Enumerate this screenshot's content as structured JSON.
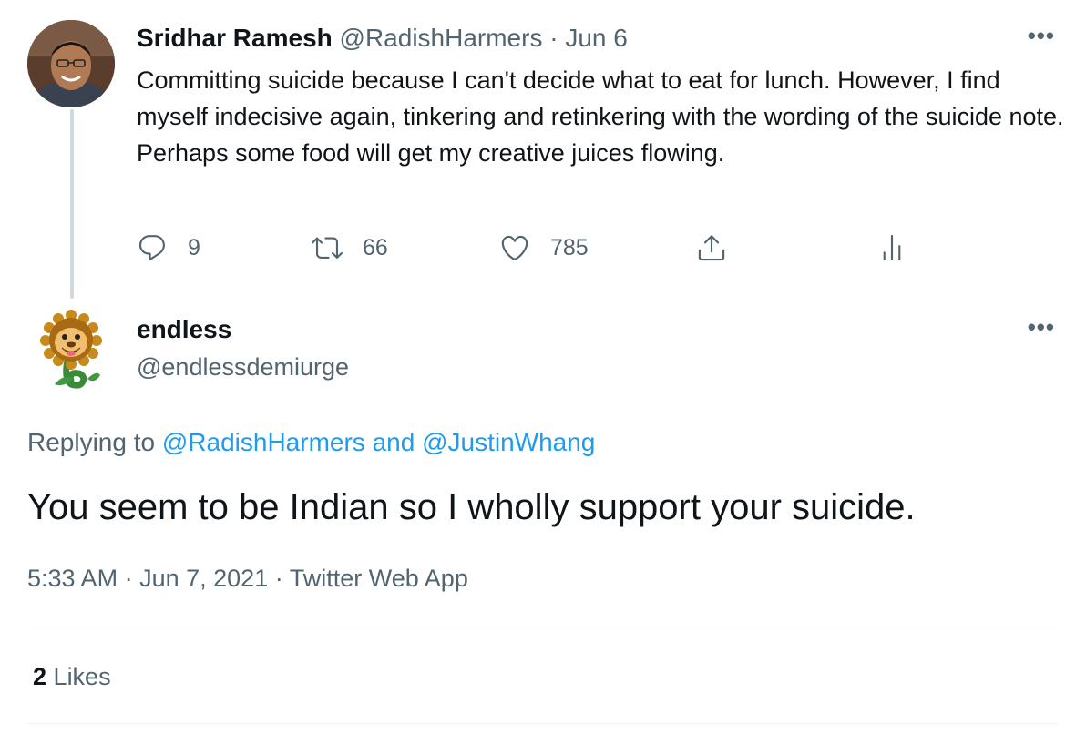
{
  "original_tweet": {
    "display_name": "Sridhar Ramesh",
    "handle": "@RadishHarmers",
    "separator": "·",
    "date": "Jun 6",
    "text": "Committing suicide because I can't decide what to eat for lunch. However, I find myself indecisive again, tinkering and retinkering with the wording of the suicide note. Perhaps some food will get my creative juices flowing.",
    "reply_count": "9",
    "retweet_count": "66",
    "like_count": "785",
    "more_label": "•••"
  },
  "reply_tweet": {
    "display_name": "endless",
    "handle": "@endlessdemiurge",
    "replying_prefix": "Replying to",
    "replying_user_1": "@RadishHarmers",
    "replying_and": "and",
    "replying_user_2": "@JustinWhang",
    "text": "You seem to be Indian so I wholly support your suicide.",
    "time": "5:33 AM",
    "meta_separator": "·",
    "date": "Jun 7, 2021",
    "source": "Twitter Web App",
    "likes_count": "2",
    "likes_label": "Likes",
    "more_label": "•••"
  },
  "icons": {
    "reply": "reply-icon",
    "retweet": "retweet-icon",
    "like": "heart-icon",
    "share": "share-icon",
    "analytics": "analytics-icon",
    "more": "more-icon"
  },
  "colors": {
    "text_primary": "#0f1419",
    "text_secondary": "#536471",
    "link": "#1d9bf0",
    "thread_line": "#cfd9de",
    "divider": "#eff3f4"
  }
}
